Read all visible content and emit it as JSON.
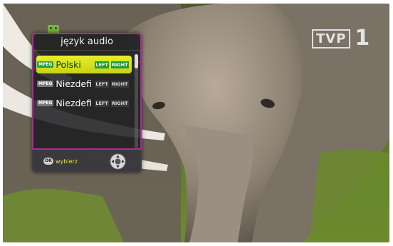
{
  "osd": {
    "channel_logo": {
      "text": "TVP",
      "number": "1"
    },
    "audio_menu": {
      "title": "język audio",
      "tracks": [
        {
          "codec_badge": "MPEG",
          "language": "Polski",
          "left": "LEFT",
          "right": "RIGHT",
          "selected": true
        },
        {
          "codec_badge": "MPEG",
          "language": "Niezdefi",
          "left": "LEFT",
          "right": "RIGHT",
          "selected": false
        },
        {
          "codec_badge": "MPEG",
          "language": "Niezdefi",
          "left": "LEFT",
          "right": "RIGHT",
          "selected": false
        }
      ],
      "footer": {
        "ok_label": "OK",
        "hint": "wybierz"
      }
    }
  },
  "colors": {
    "menu_border": "#a72c93",
    "highlight": "#e7ee2a",
    "hint_text": "#e7e04a",
    "check": "#d21e1e",
    "badge_green": "#1fa14a"
  },
  "icons": [
    "menu-top-icon",
    "check-icon",
    "dpad-icon",
    "ok-key-icon"
  ]
}
